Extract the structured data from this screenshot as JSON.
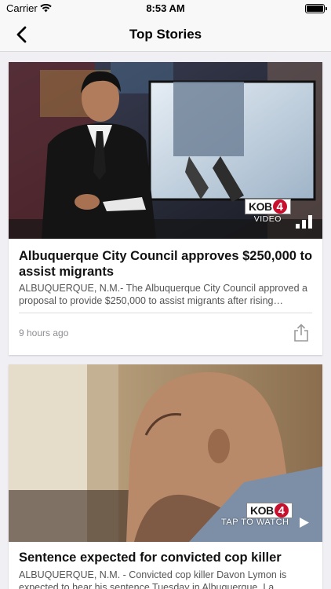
{
  "status_bar": {
    "carrier": "Carrier",
    "time": "8:53 AM"
  },
  "nav": {
    "title": "Top Stories",
    "back_icon": "chevron-left-icon"
  },
  "brand": {
    "logo_text": "KOB",
    "logo_number": "4",
    "accent": "#c8102e"
  },
  "stories": [
    {
      "headline": "Albuquerque City Council approves $250,000 to assist migrants",
      "summary": "ALBUQUERQUE, N.M.- The Albuquerque City Council approved a proposal to provide $250,000 to assist migrants after rising numbers of asylum seekers arrived in the city.",
      "media_label": "VIDEO",
      "timestamp": "9 hours ago",
      "share_icon": "share-icon"
    },
    {
      "headline": "Sentence expected for convicted cop killer",
      "summary": "ALBUQUERQUE, N.M. - Convicted cop killer Davon Lymon is expected to hear his sentence Tuesday in Albuquerque. La",
      "media_label": "TAP TO WATCH"
    }
  ]
}
